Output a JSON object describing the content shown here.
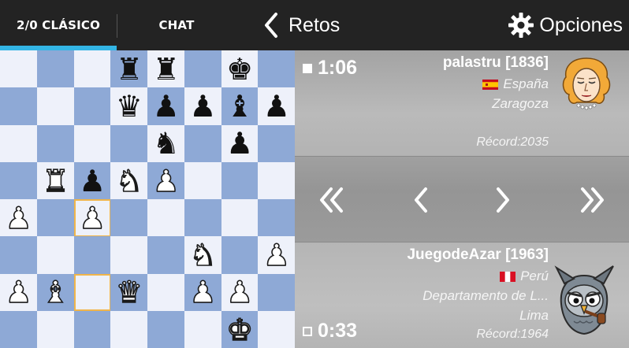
{
  "header": {
    "tab_game": "2/0 CLÁSICO",
    "tab_chat": "CHAT",
    "back_label": "Retos",
    "options_label": "Opciones",
    "accent_color": "#33b5e5"
  },
  "board": {
    "light_color": "#eef1fa",
    "dark_color": "#8ea9d6",
    "highlight_color": "#f0b54a",
    "ranks": [
      [
        "",
        "",
        "",
        "bR",
        "bR",
        "",
        "bK",
        ""
      ],
      [
        "",
        "",
        "",
        "bQ",
        "bP",
        "bP",
        "bB",
        "bP"
      ],
      [
        "",
        "",
        "",
        "",
        "bN",
        "",
        "bP",
        ""
      ],
      [
        "",
        "wR",
        "bP",
        "wN",
        "wP",
        "",
        "",
        ""
      ],
      [
        "wP",
        "",
        "wP",
        "",
        "",
        "",
        "",
        ""
      ],
      [
        "",
        "",
        "",
        "",
        "",
        "wN",
        "",
        "wP"
      ],
      [
        "wP",
        "wB",
        "",
        "wQ",
        "",
        "wP",
        "wP",
        ""
      ],
      [
        "",
        "",
        "",
        "",
        "",
        "",
        "wK",
        ""
      ]
    ],
    "highlighted": [
      "4-2",
      "6-2"
    ]
  },
  "top_player": {
    "clock": "1:06",
    "name": "palastru [1836]",
    "country": "España",
    "city": "Zaragoza",
    "record": "Récord:2035",
    "flag_icon": "spain-flag-icon",
    "avatar_icon": "woman-avatar-icon"
  },
  "navigation": {
    "first": "«",
    "prev": "‹",
    "next": "›",
    "last": "»"
  },
  "bottom_player": {
    "clock": "0:33",
    "name": "JuegodeAzar [1963]",
    "country": "Perú",
    "region": "Departamento de L...",
    "city": "Lima",
    "record": "Récord:1964",
    "flag_icon": "peru-flag-icon",
    "avatar_icon": "owl-avatar-icon"
  }
}
